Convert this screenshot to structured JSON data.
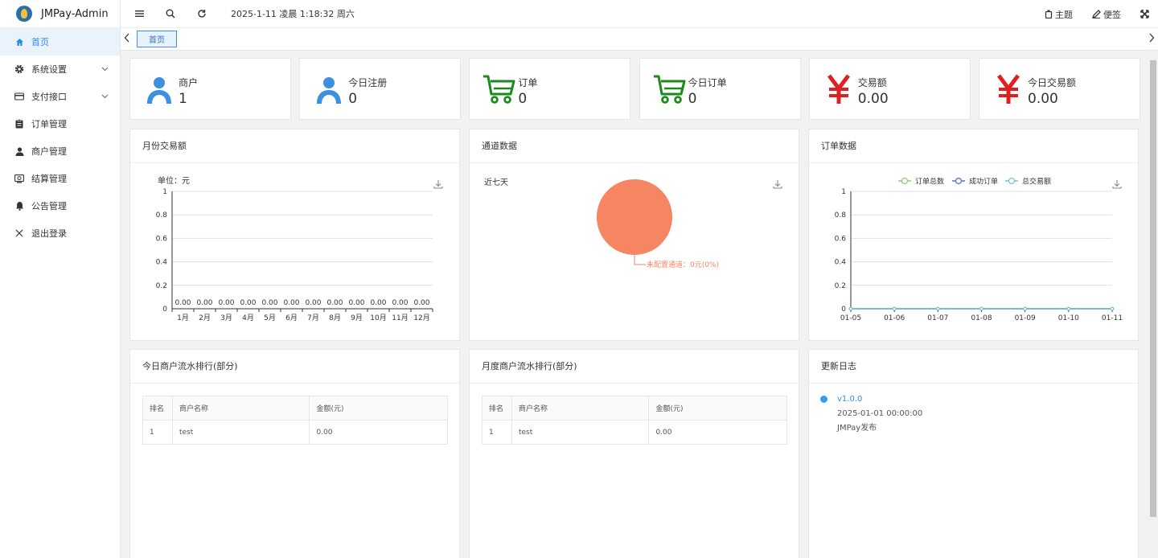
{
  "app": {
    "title": "JMPay-Admin"
  },
  "topbar": {
    "datetime": "2025-1-11 凌晨 1:18:32 周六",
    "theme_label": "主题",
    "notes_label": "便签"
  },
  "sidebar": {
    "items": [
      {
        "label": "首页",
        "icon": "home-icon",
        "active": true
      },
      {
        "label": "系统设置",
        "icon": "gear-icon",
        "expandable": true
      },
      {
        "label": "支付接口",
        "icon": "card-icon",
        "expandable": true
      },
      {
        "label": "订单管理",
        "icon": "clipboard-icon"
      },
      {
        "label": "商户管理",
        "icon": "user-icon"
      },
      {
        "label": "结算管理",
        "icon": "settle-icon"
      },
      {
        "label": "公告管理",
        "icon": "bell-icon"
      },
      {
        "label": "退出登录",
        "icon": "close-icon"
      }
    ]
  },
  "tabs": [
    {
      "label": "首页",
      "active": true
    }
  ],
  "stats": [
    {
      "label": "商户",
      "value": "1",
      "icon": "user-icon",
      "color": "#3d8fe0"
    },
    {
      "label": "今日注册",
      "value": "0",
      "icon": "user-icon",
      "color": "#3d8fe0"
    },
    {
      "label": "订单",
      "value": "0",
      "icon": "cart-icon",
      "color": "#1a8a1a"
    },
    {
      "label": "今日订单",
      "value": "0",
      "icon": "cart-icon",
      "color": "#1a8a1a"
    },
    {
      "label": "交易额",
      "value": "0.00",
      "icon": "yuan-icon",
      "color": "#e02020"
    },
    {
      "label": "今日交易额",
      "value": "0.00",
      "icon": "yuan-icon",
      "color": "#e02020"
    }
  ],
  "panels": {
    "monthly": {
      "title": "月份交易额"
    },
    "channel": {
      "title": "通道数据"
    },
    "orders": {
      "title": "订单数据"
    },
    "today_rank": {
      "title": "今日商户流水排行(部分)"
    },
    "month_rank": {
      "title": "月度商户流水排行(部分)"
    },
    "changelog": {
      "title": "更新日志"
    }
  },
  "rank_table": {
    "headers": [
      "排名",
      "商户名称",
      "金额(元)"
    ],
    "today_rows": [
      [
        "1",
        "test",
        "0.00"
      ]
    ],
    "month_rows": [
      [
        "1",
        "test",
        "0.00"
      ]
    ]
  },
  "changelog": [
    {
      "version": "v1.0.0",
      "date": "2025-01-01 00:00:00",
      "note": "JMPay发布"
    }
  ],
  "chart_data": [
    {
      "type": "bar",
      "subtitle": "单位：元",
      "categories": [
        "1月",
        "2月",
        "3月",
        "4月",
        "5月",
        "6月",
        "7月",
        "8月",
        "9月",
        "10月",
        "11月",
        "12月"
      ],
      "values": [
        0,
        0,
        0,
        0,
        0,
        0,
        0,
        0,
        0,
        0,
        0,
        0
      ],
      "data_labels": [
        "0.00",
        "0.00",
        "0.00",
        "0.00",
        "0.00",
        "0.00",
        "0.00",
        "0.00",
        "0.00",
        "0.00",
        "0.00",
        "0.00"
      ],
      "yticks": [
        "0",
        "0.2",
        "0.4",
        "0.6",
        "0.8",
        "1"
      ],
      "ylim": [
        0,
        1
      ],
      "grid": true
    },
    {
      "type": "pie",
      "subtitle": "近七天",
      "slices": [
        {
          "label": "未配置通道：0元(0%)",
          "value": 0,
          "color": "#f58563"
        }
      ]
    },
    {
      "type": "line",
      "x": [
        "01-05",
        "01-06",
        "01-07",
        "01-08",
        "01-09",
        "01-10",
        "01-11"
      ],
      "series": [
        {
          "name": "订单总数",
          "values": [
            0,
            0,
            0,
            0,
            0,
            0,
            0
          ],
          "color": "#91cc75"
        },
        {
          "name": "成功订单",
          "values": [
            0,
            0,
            0,
            0,
            0,
            0,
            0
          ],
          "color": "#5470c6"
        },
        {
          "name": "总交易额",
          "values": [
            0,
            0,
            0,
            0,
            0,
            0,
            0
          ],
          "color": "#73c0de"
        }
      ],
      "yticks": [
        "0",
        "0.2",
        "0.4",
        "0.6",
        "0.8",
        "1"
      ],
      "ylim": [
        0,
        1
      ],
      "legend": "top-center",
      "grid": true
    }
  ]
}
